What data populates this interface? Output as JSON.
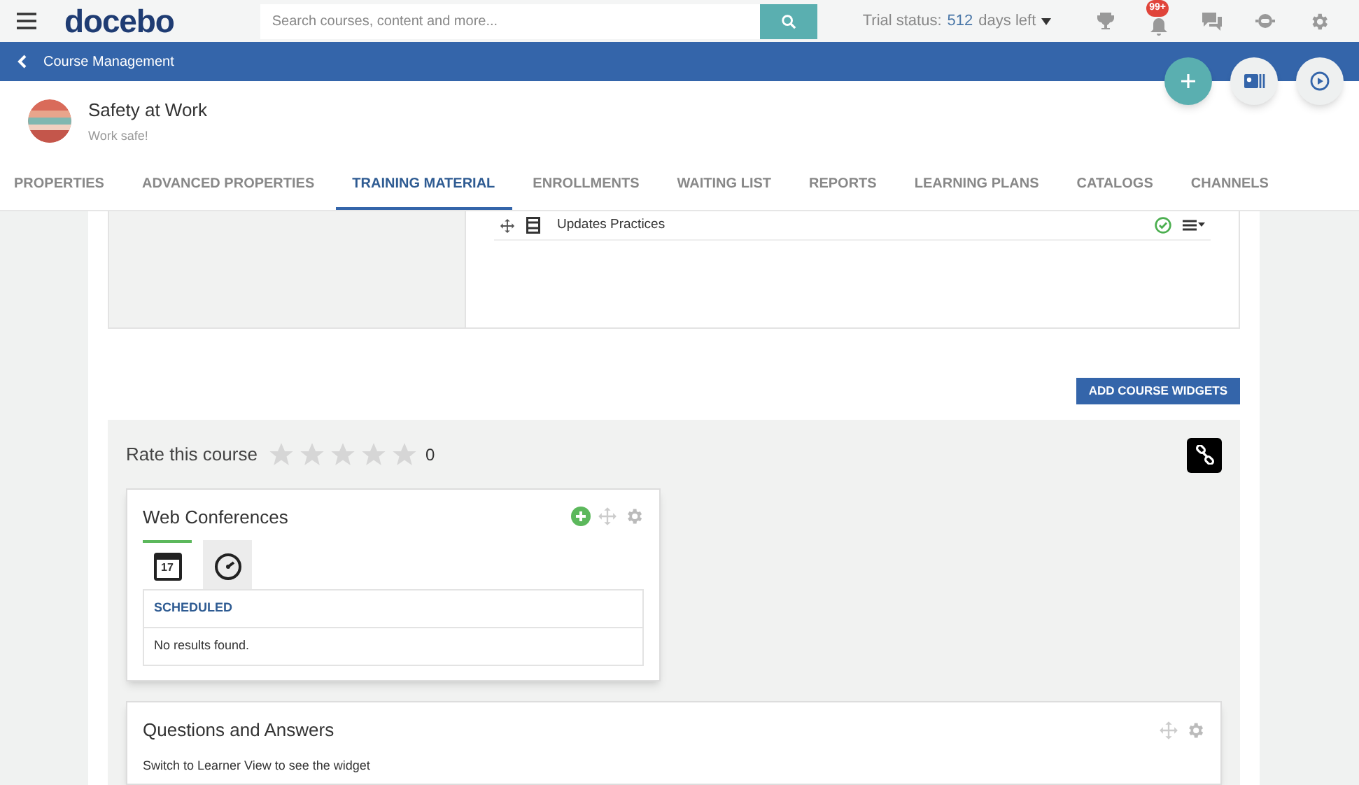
{
  "topbar": {
    "logo": "docebo",
    "search": {
      "placeholder": "Search courses, content and more..."
    },
    "trial": {
      "label": "Trial status:",
      "days": "512",
      "suffix": "days left"
    },
    "notification_badge": "99+"
  },
  "breadcrumb": "Course Management",
  "course": {
    "title": "Safety at Work",
    "subtitle": "Work safe!"
  },
  "tabs": [
    {
      "label": "PROPERTIES",
      "selected": false
    },
    {
      "label": "ADVANCED PROPERTIES",
      "selected": false
    },
    {
      "label": "TRAINING MATERIAL",
      "selected": true
    },
    {
      "label": "ENROLLMENTS",
      "selected": false
    },
    {
      "label": "WAITING LIST",
      "selected": false
    },
    {
      "label": "REPORTS",
      "selected": false
    },
    {
      "label": "LEARNING PLANS",
      "selected": false
    },
    {
      "label": "CATALOGS",
      "selected": false
    },
    {
      "label": "CHANNELS",
      "selected": false
    }
  ],
  "materials": [
    {
      "title": "Updates Practices",
      "completed": true
    }
  ],
  "add_widgets_button": "ADD COURSE WIDGETS",
  "rating": {
    "label": "Rate this course",
    "stars": 0,
    "count": "0"
  },
  "web_conferences": {
    "title": "Web Conferences",
    "calendar_day": "17",
    "tabs": [
      {
        "kind": "calendar",
        "selected": true
      },
      {
        "kind": "clock",
        "selected": false
      }
    ],
    "section": "SCHEDULED",
    "empty": "No results found."
  },
  "qa": {
    "title": "Questions and Answers",
    "note": "Switch to Learner View to see the widget"
  }
}
